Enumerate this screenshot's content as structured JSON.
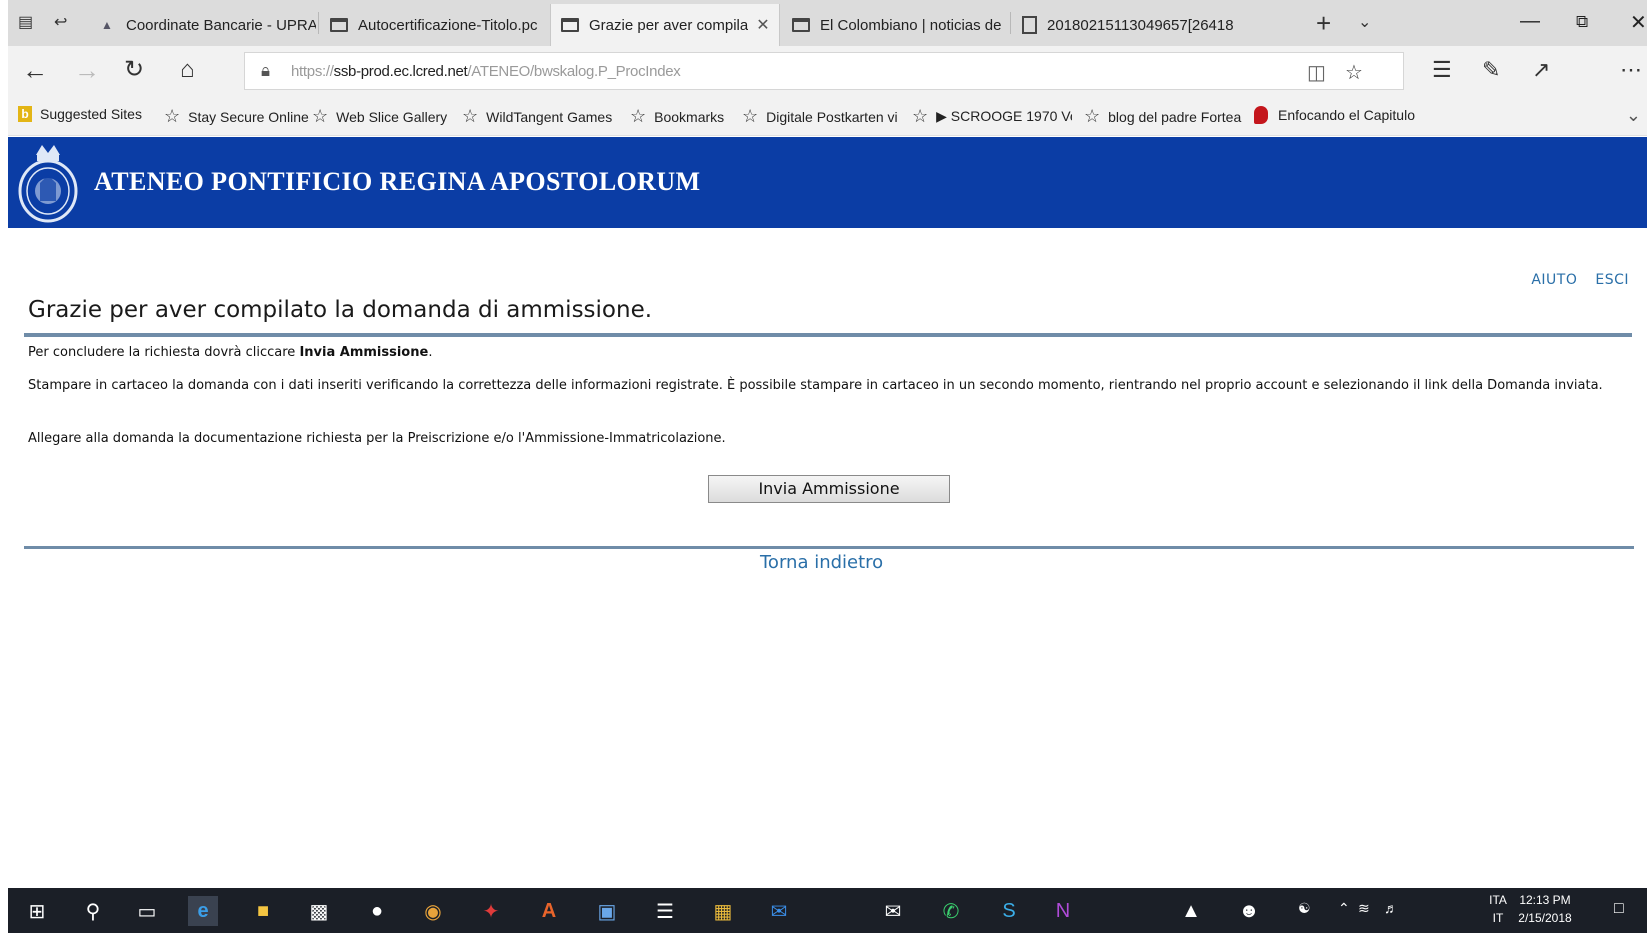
{
  "browser": {
    "tabs": [
      {
        "label": "Coordinate Bancarie - UPRA",
        "icon": "person-icon",
        "active": false
      },
      {
        "label": "Autocertificazione-Titolo.pc",
        "icon": "page-icon",
        "active": false
      },
      {
        "label": "Grazie per aver compila",
        "icon": "page-icon",
        "active": true
      },
      {
        "label": "El Colombiano | noticias de",
        "icon": "page-icon",
        "active": false
      },
      {
        "label": "20180215113049657[26418",
        "icon": "pdf-icon",
        "active": false
      }
    ],
    "address": {
      "scheme": "https://",
      "host": "ssb-prod.ec.lcred.net",
      "path": "/ATENEO/bwskalog.P_ProcIndex"
    },
    "favorites": [
      {
        "label": "Suggested Sites",
        "icon": "bing-icon"
      },
      {
        "label": "Stay Secure Online",
        "icon": "star-icon"
      },
      {
        "label": "Web Slice Gallery",
        "icon": "star-icon"
      },
      {
        "label": "WildTangent Games",
        "icon": "star-icon"
      },
      {
        "label": "Bookmarks",
        "icon": "star-icon"
      },
      {
        "label": "Digitale Postkarten vi",
        "icon": "star-icon"
      },
      {
        "label": "▶ SCROOGE 1970 Ve",
        "icon": "star-icon"
      },
      {
        "label": "blog del padre Fortea",
        "icon": "star-icon"
      },
      {
        "label": "Enfocando el Capitulo",
        "icon": "red-leaf-icon"
      }
    ]
  },
  "site": {
    "title": "ATENEO PONTIFICIO REGINA APOSTOLORUM",
    "links": {
      "help": "AIUTO",
      "exit": "ESCI"
    },
    "page_title": "Grazie per aver compilato la domanda di ammissione.",
    "p1_text": "Per concludere la richiesta dovrà cliccare ",
    "p1_bold": "Invia Ammissione",
    "p1_end": ".",
    "p2": "Stampare in cartaceo la domanda con i dati inseriti verificando la correttezza delle informazioni registrate. È possibile stampare in cartaceo in un secondo momento, rientrando nel proprio account e selezionando il link della Domanda inviata.",
    "p3": "Allegare alla domanda la documentazione richiesta per la Preiscrizione e/o l'Ammissione-Immatricolazione.",
    "submit_label": "Invia Ammissione",
    "back_label": "Torna indietro"
  },
  "taskbar": {
    "lang_top": "ITA",
    "lang_bottom": "IT",
    "time": "12:13 PM",
    "date": "2/15/2018"
  },
  "colors": {
    "header_blue": "#0b3da5",
    "link_blue": "#2a6fa8",
    "rule": "#6f8ca8"
  }
}
